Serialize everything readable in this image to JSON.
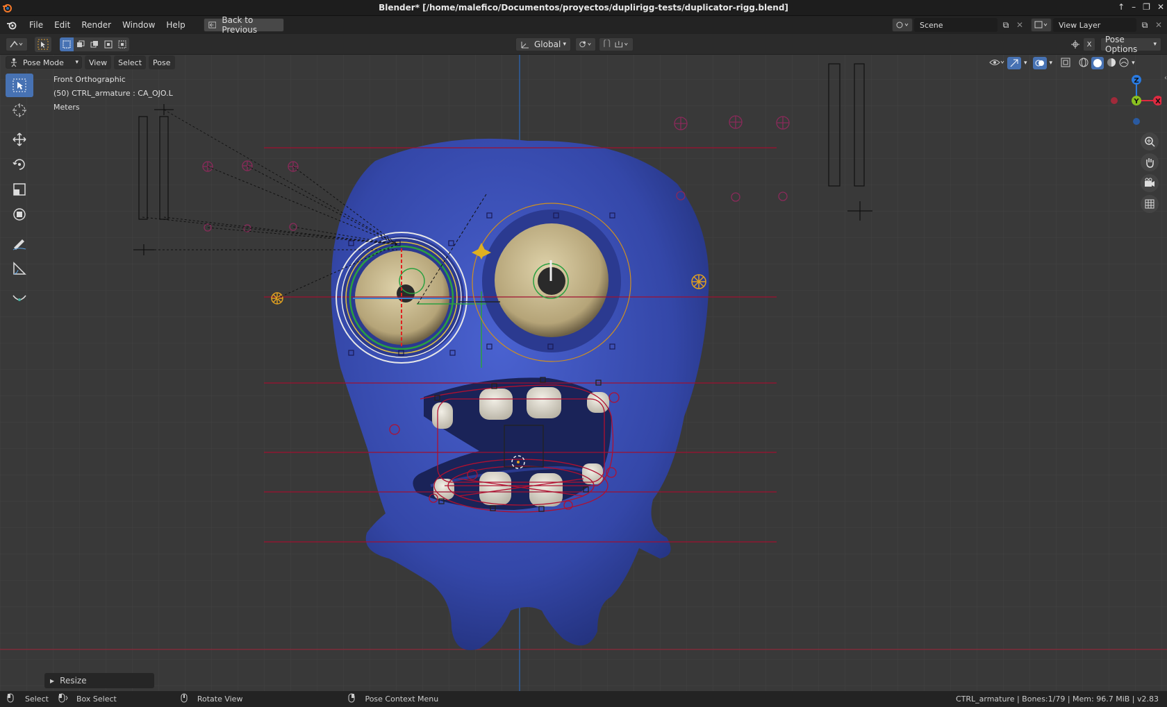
{
  "window": {
    "title": "Blender* [/home/malefico/Documentos/proyectos/duplirigg-tests/duplicator-rigg.blend]"
  },
  "menu": {
    "items": [
      "File",
      "Edit",
      "Render",
      "Window",
      "Help"
    ],
    "back_button": "Back to Previous"
  },
  "scene": {
    "scene_name": "Scene",
    "view_layer": "View Layer"
  },
  "header": {
    "orientation": "Global",
    "pose_options": "Pose Options"
  },
  "mode_bar": {
    "mode": "Pose Mode",
    "menus": [
      "View",
      "Select",
      "Pose"
    ]
  },
  "viewport_info": {
    "view_name": "Front Orthographic",
    "active_bone": "(50) CTRL_armature : CA_OJO.L",
    "units": "Meters"
  },
  "gizmo": {
    "z": "Z",
    "y": "Y",
    "x": "X"
  },
  "operator_panel": {
    "label": "Resize"
  },
  "status": {
    "select": "Select",
    "box_select": "Box Select",
    "rotate_view": "Rotate View",
    "context_menu": "Pose Context Menu",
    "info": "CTRL_armature | Bones:1/79 | Mem: 96.7 MiB | v2.83"
  },
  "colors": {
    "accent": "#4772b3",
    "mesh": "#3b4fb8",
    "eye": "#c9b98e",
    "bone_select": "#e0b030",
    "constraint_red": "#b01030",
    "bone_pink": "#8a2a5a"
  }
}
